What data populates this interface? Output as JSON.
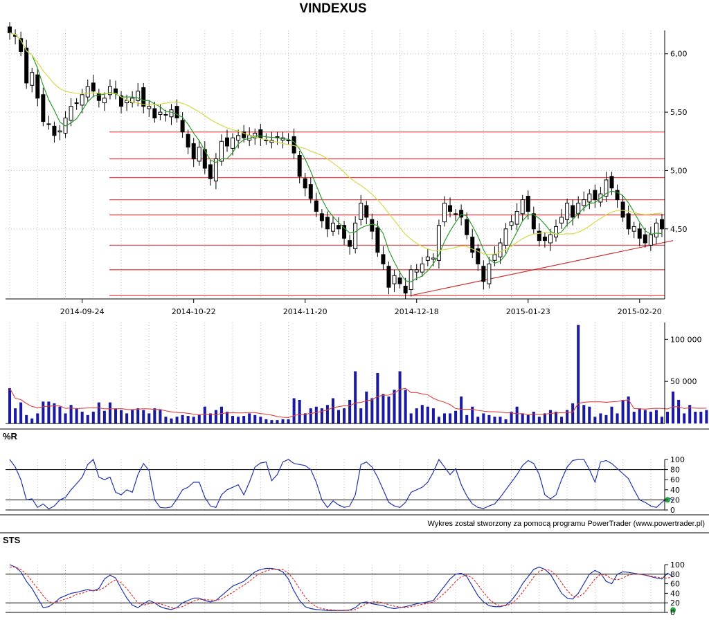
{
  "page": {
    "title": "VINDEXUS",
    "credit": "Wykres został stworzony za pomocą programu PowerTrader (www.powertrader.pl)"
  },
  "chart_data": [
    {
      "id": "price",
      "type": "candlestick",
      "title": "VINDEXUS",
      "x_labels": [
        "2014-09-24",
        "2014-10-22",
        "2014-11-20",
        "2014-12-18",
        "2015-01-23",
        "2015-02-20"
      ],
      "x_label_index": [
        13,
        33,
        53,
        73,
        93,
        113
      ],
      "y_ticks": [
        "4,50",
        "5,00",
        "5,50",
        "6,00"
      ],
      "y_tick_values": [
        4.5,
        5.0,
        5.5,
        6.0
      ],
      "ylim": [
        3.9,
        6.2
      ],
      "grid": true,
      "close": [
        6.18,
        6.15,
        6.02,
        5.75,
        5.84,
        5.62,
        5.42,
        5.4,
        5.3,
        5.34,
        5.45,
        5.55,
        5.58,
        5.65,
        5.72,
        5.68,
        5.6,
        5.62,
        5.72,
        5.66,
        5.55,
        5.6,
        5.62,
        5.68,
        5.55,
        5.55,
        5.45,
        5.5,
        5.48,
        5.52,
        5.45,
        5.33,
        5.2,
        5.1,
        5.2,
        5.02,
        4.93,
        5.1,
        5.25,
        5.21,
        5.28,
        5.3,
        5.28,
        5.3,
        5.32,
        5.28,
        5.26,
        5.26,
        5.28,
        5.28,
        5.26,
        5.15,
        4.95,
        4.85,
        4.76,
        4.65,
        4.57,
        4.5,
        4.55,
        4.5,
        4.42,
        4.35,
        4.55,
        4.72,
        4.6,
        4.48,
        4.3,
        4.2,
        4.0,
        4.1,
        4.03,
        3.95,
        4.15,
        4.15,
        4.2,
        4.26,
        4.25,
        4.53,
        4.72,
        4.65,
        4.63,
        4.6,
        4.45,
        4.3,
        4.2,
        4.05,
        4.2,
        4.28,
        4.38,
        4.5,
        4.56,
        4.65,
        4.75,
        4.65,
        4.5,
        4.4,
        4.4,
        4.45,
        4.52,
        4.6,
        4.72,
        4.6,
        4.72,
        4.75,
        4.8,
        4.75,
        4.8,
        4.92,
        4.85,
        4.75,
        4.6,
        4.5,
        4.52,
        4.42,
        4.38,
        4.45,
        4.55,
        4.5
      ],
      "mas": [
        {
          "period": 5,
          "color": "#2d9a2d"
        },
        {
          "period": 20,
          "color": "#d8d84a"
        }
      ],
      "hlines": [
        5.33,
        5.1,
        4.94,
        4.75,
        4.62,
        4.36,
        4.15,
        3.93
      ],
      "trendline": {
        "from": {
          "index": 72,
          "value": 3.93
        },
        "to": {
          "index": 119,
          "value": 4.4
        }
      }
    },
    {
      "id": "volume",
      "type": "bar",
      "y_ticks": [
        "50 000",
        "100 000"
      ],
      "y_tick_values": [
        50000,
        100000
      ],
      "ylim": [
        0,
        120000
      ],
      "values": [
        42000,
        18000,
        25000,
        10000,
        6000,
        12000,
        26000,
        26000,
        24000,
        20000,
        12000,
        22000,
        18000,
        14000,
        10000,
        14000,
        25000,
        15000,
        25000,
        18000,
        16000,
        12000,
        16000,
        18000,
        16000,
        12000,
        18000,
        16000,
        8000,
        6000,
        8000,
        10000,
        9000,
        8000,
        10000,
        20000,
        12000,
        16000,
        20000,
        14000,
        9000,
        8000,
        9000,
        12000,
        10000,
        8000,
        5000,
        4000,
        4000,
        5000,
        5000,
        30000,
        28000,
        12000,
        18000,
        20000,
        18000,
        22000,
        30000,
        16000,
        18000,
        28000,
        62000,
        18000,
        38000,
        30000,
        60000,
        35000,
        32000,
        40000,
        62000,
        40000,
        12000,
        18000,
        22000,
        20000,
        18000,
        8000,
        12000,
        12000,
        15000,
        32000,
        10000,
        20000,
        8000,
        12000,
        10000,
        8000,
        8000,
        5000,
        14000,
        20000,
        12000,
        10000,
        14000,
        8000,
        12000,
        16000,
        14000,
        8000,
        16000,
        24000,
        117000,
        22000,
        20000,
        8000,
        12000,
        10000,
        20000,
        12000,
        28000,
        32000,
        14000,
        18000,
        16000,
        14000,
        16000,
        8000,
        14000,
        38000,
        28000,
        12000,
        22000,
        14000,
        14000,
        16000
      ],
      "ma_color": "#e04040",
      "ma_period": 10
    },
    {
      "id": "williams",
      "type": "line",
      "title": "%R",
      "y_ticks": [
        "0",
        "20",
        "40",
        "60",
        "80",
        "100"
      ],
      "y_tick_values": [
        0,
        20,
        40,
        60,
        80,
        100
      ],
      "ylim": [
        0,
        100
      ],
      "levels": [
        20,
        80
      ],
      "values": [
        100,
        85,
        60,
        20,
        22,
        5,
        12,
        2,
        8,
        20,
        25,
        40,
        52,
        65,
        90,
        100,
        65,
        60,
        65,
        35,
        30,
        40,
        35,
        70,
        92,
        78,
        20,
        5,
        4,
        6,
        22,
        40,
        45,
        55,
        55,
        25,
        8,
        5,
        30,
        40,
        45,
        50,
        30,
        55,
        85,
        93,
        95,
        58,
        70,
        95,
        100,
        92,
        90,
        88,
        80,
        55,
        20,
        5,
        18,
        10,
        5,
        8,
        30,
        90,
        95,
        85,
        65,
        40,
        15,
        8,
        5,
        15,
        35,
        40,
        45,
        55,
        75,
        100,
        85,
        70,
        82,
        50,
        28,
        12,
        5,
        3,
        8,
        12,
        25,
        40,
        55,
        70,
        88,
        98,
        92,
        70,
        30,
        22,
        30,
        60,
        85,
        98,
        100,
        100,
        80,
        55,
        95,
        98,
        92,
        82,
        72,
        62,
        40,
        20,
        15,
        8,
        5,
        15,
        25,
        20
      ],
      "marker": {
        "index": 118,
        "value": 20,
        "color": "#22aa44"
      }
    },
    {
      "id": "sts",
      "type": "line",
      "title": "STS",
      "y_ticks": [
        "0",
        "20",
        "40",
        "60",
        "80",
        "100"
      ],
      "y_tick_values": [
        0,
        20,
        40,
        60,
        80,
        100
      ],
      "ylim": [
        0,
        100
      ],
      "levels": [
        20,
        80
      ],
      "series": [
        {
          "color": "#2233aa",
          "values": [
            100,
            95,
            85,
            65,
            50,
            30,
            10,
            12,
            20,
            30,
            35,
            40,
            42,
            45,
            48,
            45,
            50,
            70,
            78,
            72,
            50,
            30,
            15,
            10,
            18,
            25,
            20,
            12,
            8,
            6,
            10,
            20,
            25,
            30,
            30,
            25,
            22,
            25,
            35,
            45,
            55,
            60,
            65,
            75,
            85,
            90,
            92,
            92,
            90,
            85,
            70,
            45,
            25,
            12,
            8,
            6,
            5,
            4,
            4,
            4,
            4,
            5,
            10,
            20,
            22,
            18,
            16,
            14,
            10,
            8,
            10,
            12,
            15,
            18,
            20,
            22,
            25,
            40,
            55,
            70,
            80,
            82,
            75,
            55,
            35,
            22,
            14,
            12,
            12,
            15,
            25,
            40,
            60,
            75,
            90,
            95,
            90,
            80,
            60,
            40,
            30,
            28,
            40,
            60,
            80,
            88,
            82,
            65,
            60,
            80,
            85,
            84,
            82,
            80,
            78,
            75,
            72,
            70,
            82,
            75
          ]
        },
        {
          "color": "#dd3333",
          "dashed": true,
          "values": [
            95,
            95,
            90,
            80,
            65,
            50,
            35,
            22,
            20,
            24,
            28,
            32,
            38,
            40,
            45,
            46,
            46,
            52,
            62,
            68,
            62,
            50,
            35,
            20,
            15,
            18,
            20,
            18,
            14,
            10,
            9,
            12,
            18,
            24,
            27,
            27,
            26,
            25,
            28,
            35,
            42,
            50,
            57,
            65,
            75,
            82,
            87,
            90,
            90,
            90,
            82,
            68,
            50,
            32,
            20,
            12,
            8,
            6,
            5,
            4,
            4,
            4,
            6,
            12,
            18,
            22,
            22,
            20,
            16,
            13,
            11,
            10,
            12,
            14,
            17,
            19,
            22,
            30,
            40,
            52,
            65,
            75,
            78,
            72,
            58,
            42,
            28,
            18,
            14,
            14,
            18,
            28,
            42,
            58,
            74,
            86,
            90,
            88,
            78,
            62,
            46,
            34,
            32,
            40,
            55,
            70,
            80,
            78,
            70,
            68,
            72,
            78,
            80,
            80,
            78,
            76,
            74,
            72,
            72,
            75
          ]
        }
      ],
      "marker": {
        "index": 119,
        "value": 5,
        "color": "#22aa44"
      }
    }
  ]
}
